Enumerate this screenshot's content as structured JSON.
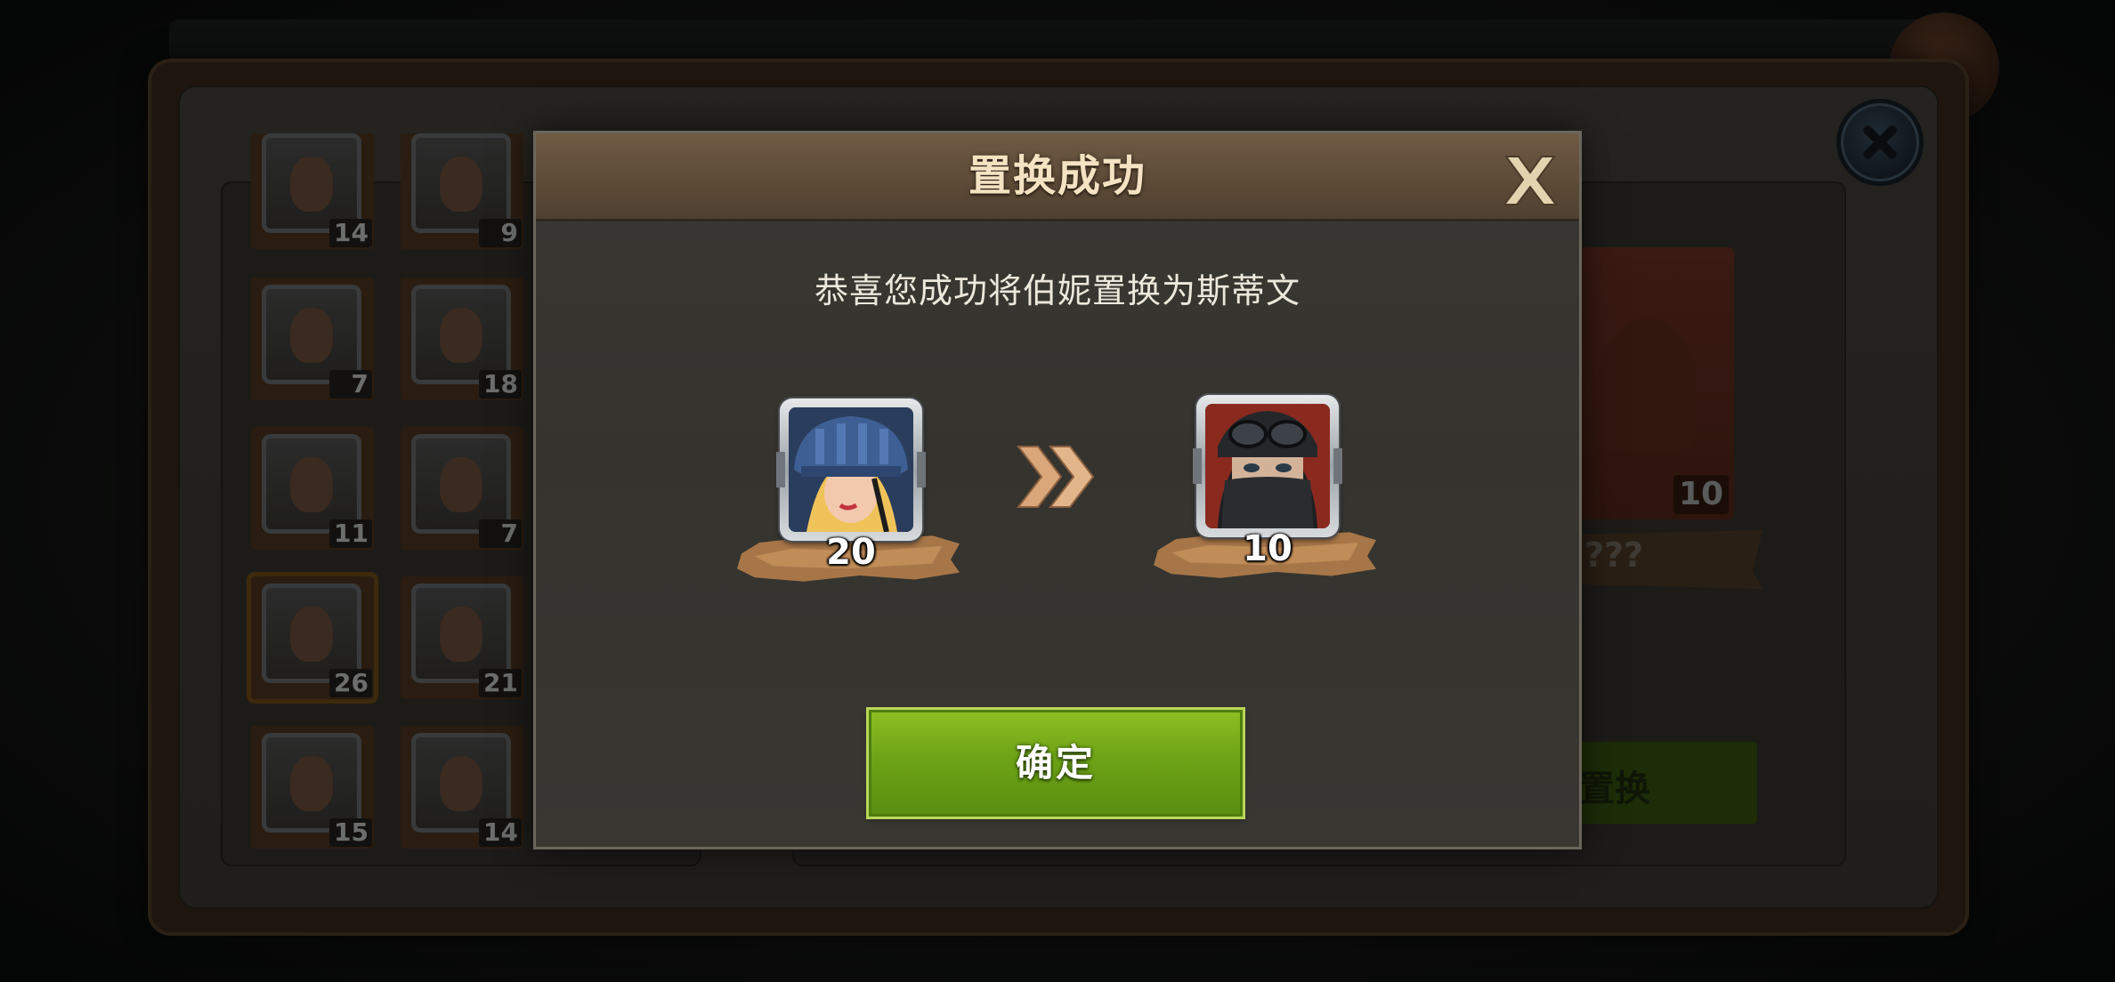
{
  "background": {
    "title": "",
    "hero_list": [
      {
        "level": "14"
      },
      {
        "level": "9"
      },
      {
        "level": "7"
      },
      {
        "level": "18"
      },
      {
        "level": "11"
      },
      {
        "level": "7"
      },
      {
        "level": "26",
        "selected": true
      },
      {
        "level": "21"
      },
      {
        "level": "15"
      },
      {
        "level": "14"
      }
    ],
    "target_card": {
      "level": "10",
      "name": "???"
    },
    "swap_button_label": "置换"
  },
  "modal": {
    "title": "置换成功",
    "message": "恭喜您成功将伯妮置换为斯蒂文",
    "from_hero": {
      "level": "20",
      "icon": "helmet-girl-portrait"
    },
    "to_hero": {
      "level": "10",
      "icon": "masked-soldier-portrait"
    },
    "arrow_icon": "double-chevron-right-icon",
    "confirm_label": "确定",
    "close_icon": "close-x-icon"
  },
  "colors": {
    "modal_header": "#5c4a37",
    "modal_title": "#f4e3c2",
    "confirm_button": "#6da316",
    "arrow": "#d9a77a",
    "level_brush": "#a77648"
  }
}
